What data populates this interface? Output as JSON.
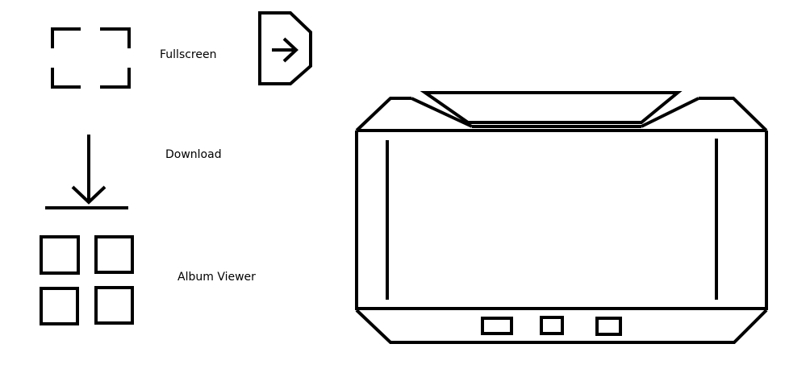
{
  "legend": {
    "fullscreen": {
      "label": "Fullscreen",
      "icon": "fullscreen-icon"
    },
    "download": {
      "label": "Download",
      "icon": "download-icon"
    },
    "album_viewer": {
      "label": "Album Viewer",
      "icon": "album-viewer-icon"
    }
  },
  "misc_icons": [
    "exit-arrow-icon",
    "device-frame"
  ],
  "colors": {
    "stroke": "#000000",
    "background": "#ffffff"
  }
}
